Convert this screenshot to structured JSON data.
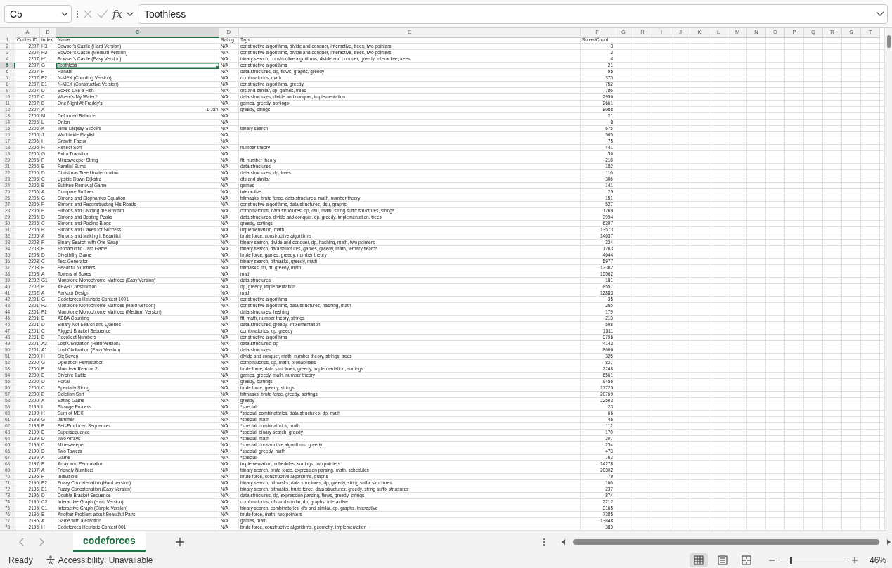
{
  "formula_bar": {
    "name_box": "C5",
    "function_label": "fx",
    "formula": "Toothless"
  },
  "columns": [
    {
      "label": "A",
      "selected": false
    },
    {
      "label": "B",
      "selected": false
    },
    {
      "label": "C",
      "selected": true
    },
    {
      "label": "D",
      "selected": false
    },
    {
      "label": "E",
      "selected": false
    },
    {
      "label": "F",
      "selected": false
    },
    {
      "label": "G",
      "selected": false
    },
    {
      "label": "H",
      "selected": false
    },
    {
      "label": "I",
      "selected": false
    },
    {
      "label": "J",
      "selected": false
    },
    {
      "label": "K",
      "selected": false
    },
    {
      "label": "L",
      "selected": false
    },
    {
      "label": "M",
      "selected": false
    },
    {
      "label": "N",
      "selected": false
    },
    {
      "label": "O",
      "selected": false
    },
    {
      "label": "P",
      "selected": false
    },
    {
      "label": "Q",
      "selected": false
    },
    {
      "label": "R",
      "selected": false
    },
    {
      "label": "S",
      "selected": false
    },
    {
      "label": "T",
      "selected": false
    }
  ],
  "header": {
    "n": "1",
    "contest_id": "ContestID",
    "index": "Index",
    "name": "Name",
    "rating": "Rating",
    "tags": "Tags",
    "solved_count": "SolvedCount"
  },
  "rows": [
    {
      "n": "2",
      "selected": false,
      "contest_id": "2207",
      "index": "H3",
      "name": "Bowser's Castle (Hard Version)",
      "rating": "N/A",
      "tags": "constructive algorithms, divide and conquer, interactive, trees, two pointers",
      "solved_count": "3"
    },
    {
      "n": "3",
      "selected": false,
      "contest_id": "2207",
      "index": "H2",
      "name": "Bowser's Castle (Medium Version)",
      "rating": "N/A",
      "tags": "constructive algorithms, divide and conquer, interactive, trees, two pointers",
      "solved_count": "2"
    },
    {
      "n": "4",
      "selected": false,
      "contest_id": "2207",
      "index": "H1",
      "name": "Bowser's Castle (Easy Version)",
      "rating": "N/A",
      "tags": "binary search, constructive algorithms, divide and conquer, greedy, interactive, trees",
      "solved_count": "4"
    },
    {
      "n": "5",
      "selected": true,
      "contest_id": "2207",
      "index": "G",
      "name": "Toothless",
      "rating": "N/A",
      "tags": "constructive algorithms",
      "solved_count": "21"
    },
    {
      "n": "6",
      "selected": false,
      "contest_id": "2207",
      "index": "F",
      "name": "Hanabi",
      "rating": "N/A",
      "tags": "data structures, dp, flows, graphs, greedy",
      "solved_count": "95"
    },
    {
      "n": "7",
      "selected": false,
      "contest_id": "2207",
      "index": "E2",
      "name": "N-MEX (Counting Version)",
      "rating": "N/A",
      "tags": "combinatorics, math",
      "solved_count": "375"
    },
    {
      "n": "8",
      "selected": false,
      "contest_id": "2207",
      "index": "E1",
      "name": "N-MEX (Constructive Version)",
      "rating": "N/A",
      "tags": "constructive algorithms, greedy",
      "solved_count": "752"
    },
    {
      "n": "9",
      "selected": false,
      "contest_id": "2207",
      "index": "D",
      "name": "Boxed Like a Fish",
      "rating": "N/A",
      "tags": "dfs and similar, dp, games, trees",
      "solved_count": "786"
    },
    {
      "n": "10",
      "selected": false,
      "contest_id": "2207",
      "index": "C",
      "name": "Where's My Water?",
      "rating": "N/A",
      "tags": "data structures, divide and conquer, implementation",
      "solved_count": "2956"
    },
    {
      "n": "11",
      "selected": false,
      "contest_id": "2207",
      "index": "B",
      "name": "One Night At Freddy's",
      "rating": "N/A",
      "tags": "games, greedy, sortings",
      "solved_count": "2661"
    },
    {
      "n": "12",
      "selected": false,
      "contest_id": "2207",
      "index": "A",
      "date": "1-Jan",
      "rating": "N/A",
      "tags": "greedy, strings",
      "solved_count": "8088"
    },
    {
      "n": "13",
      "selected": false,
      "contest_id": "2206",
      "index": "M",
      "name": "Deformed Balance",
      "rating": "N/A",
      "solved_count": "21"
    },
    {
      "n": "14",
      "selected": false,
      "contest_id": "2206",
      "index": "L",
      "name": "Onion",
      "rating": "N/A",
      "solved_count": "8"
    },
    {
      "n": "15",
      "selected": false,
      "contest_id": "2206",
      "index": "K",
      "name": "Time Display Stickers",
      "rating": "N/A",
      "tags": "binary search",
      "solved_count": "675"
    },
    {
      "n": "16",
      "selected": false,
      "contest_id": "2206",
      "index": "J",
      "name": "Worldwide Playlist",
      "rating": "N/A",
      "solved_count": "505"
    },
    {
      "n": "17",
      "selected": false,
      "contest_id": "2206",
      "index": "I",
      "name": "Growth Factor",
      "rating": "N/A",
      "solved_count": "75"
    },
    {
      "n": "18",
      "selected": false,
      "contest_id": "2206",
      "index": "H",
      "name": "Reflect Sort",
      "rating": "N/A",
      "tags": "number theory",
      "solved_count": "441"
    },
    {
      "n": "19",
      "selected": false,
      "contest_id": "2206",
      "index": "G",
      "name": "Extra Transition",
      "rating": "N/A",
      "solved_count": "36"
    },
    {
      "n": "20",
      "selected": false,
      "contest_id": "2206",
      "index": "F",
      "name": "Minesweeper String",
      "rating": "N/A",
      "tags": "fft, number theory",
      "solved_count": "218"
    },
    {
      "n": "21",
      "selected": false,
      "contest_id": "2206",
      "index": "E",
      "name": "Parallel Sums",
      "rating": "N/A",
      "tags": "data structures",
      "solved_count": "182"
    },
    {
      "n": "22",
      "selected": false,
      "contest_id": "2206",
      "index": "D",
      "name": "Christmas Tree Un-decoration",
      "rating": "N/A",
      "tags": "data structures, dp, trees",
      "solved_count": "116"
    },
    {
      "n": "23",
      "selected": false,
      "contest_id": "2206",
      "index": "C",
      "name": "Upside Down Dijkstra",
      "rating": "N/A",
      "tags": "dfs and similar",
      "solved_count": "306"
    },
    {
      "n": "24",
      "selected": false,
      "contest_id": "2206",
      "index": "B",
      "name": "Subtree Removal Game",
      "rating": "N/A",
      "tags": "games",
      "solved_count": "141"
    },
    {
      "n": "25",
      "selected": false,
      "contest_id": "2206",
      "index": "A",
      "name": "Compare Suffixes",
      "rating": "N/A",
      "tags": "interactive",
      "solved_count": "25"
    },
    {
      "n": "26",
      "selected": false,
      "contest_id": "2205",
      "index": "G",
      "name": "Simons and Diophantus Equation",
      "rating": "N/A",
      "tags": "bitmasks, brute force, data structures, math, number theory",
      "solved_count": "151"
    },
    {
      "n": "27",
      "selected": false,
      "contest_id": "2205",
      "index": "F",
      "name": "Simons and Reconstructing His Roads",
      "rating": "N/A",
      "tags": "constructive algorithms, data structures, dsu, graphs",
      "solved_count": "527"
    },
    {
      "n": "28",
      "selected": false,
      "contest_id": "2205",
      "index": "E",
      "name": "Simons and Dividing the Rhythm",
      "rating": "N/A",
      "tags": "combinatorics, data structures, dp, dsu, math, string suffix structures, strings",
      "solved_count": "1269"
    },
    {
      "n": "29",
      "selected": false,
      "contest_id": "2205",
      "index": "D",
      "name": "Simons and Beating Peaks",
      "rating": "N/A",
      "tags": "data structures, divide and conquer, dp, greedy, implementation, trees",
      "solved_count": "3994"
    },
    {
      "n": "30",
      "selected": false,
      "contest_id": "2205",
      "index": "C",
      "name": "Simons and Posting Blogs",
      "rating": "N/A",
      "tags": "greedy, sortings",
      "solved_count": "6397"
    },
    {
      "n": "31",
      "selected": false,
      "contest_id": "2205",
      "index": "B",
      "name": "Simons and Cakes for Success",
      "rating": "N/A",
      "tags": "implementation, math",
      "solved_count": "13573"
    },
    {
      "n": "32",
      "selected": false,
      "contest_id": "2205",
      "index": "A",
      "name": "Simons and Making It Beautiful",
      "rating": "N/A",
      "tags": "brute force, constructive algorithms",
      "solved_count": "14637"
    },
    {
      "n": "33",
      "selected": false,
      "contest_id": "2203",
      "index": "F",
      "name": "Binary Search with One Swap",
      "rating": "N/A",
      "tags": "binary search, divide and conquer, dp, hashing, math, two pointers",
      "solved_count": "334"
    },
    {
      "n": "34",
      "selected": false,
      "contest_id": "2203",
      "index": "E",
      "name": "Probabilistic Card Game",
      "rating": "N/A",
      "tags": "binary search, data structures, games, greedy, math, ternary search",
      "solved_count": "1263"
    },
    {
      "n": "35",
      "selected": false,
      "contest_id": "2203",
      "index": "D",
      "name": "Divisibility Game",
      "rating": "N/A",
      "tags": "brute force, games, greedy, number theory",
      "solved_count": "4644"
    },
    {
      "n": "36",
      "selected": false,
      "contest_id": "2203",
      "index": "C",
      "name": "Test Generator",
      "rating": "N/A",
      "tags": "binary search, bitmasks, greedy, math",
      "solved_count": "5977"
    },
    {
      "n": "37",
      "selected": false,
      "contest_id": "2203",
      "index": "B",
      "name": "Beautiful Numbers",
      "rating": "N/A",
      "tags": "bitmasks, dp, fft, greedy, math",
      "solved_count": "12362"
    },
    {
      "n": "38",
      "selected": false,
      "contest_id": "2203",
      "index": "A",
      "name": "Towers of Boxes",
      "rating": "N/A",
      "tags": "math",
      "solved_count": "15562"
    },
    {
      "n": "39",
      "selected": false,
      "contest_id": "2202",
      "index": "G1",
      "name": "Monotone Monochrome Matrices (Easy Version)",
      "rating": "N/A",
      "tags": "data structures",
      "solved_count": "181"
    },
    {
      "n": "40",
      "selected": false,
      "contest_id": "2202",
      "index": "B",
      "name": "ABAB Construction",
      "rating": "N/A",
      "tags": "dp, greedy, implementation",
      "solved_count": "8557"
    },
    {
      "n": "41",
      "selected": false,
      "contest_id": "2202",
      "index": "A",
      "name": "Parkour Design",
      "rating": "N/A",
      "tags": "math",
      "solved_count": "12883"
    },
    {
      "n": "42",
      "selected": false,
      "contest_id": "2201",
      "index": "G",
      "name": "Codeforces Heuristic Contest 1001",
      "rating": "N/A",
      "tags": "constructive algorithms",
      "solved_count": "35"
    },
    {
      "n": "43",
      "selected": false,
      "contest_id": "2201",
      "index": "F2",
      "name": "Monotone Monochrome Matrices (Hard Version)",
      "rating": "N/A",
      "tags": "constructive algorithms, data structures, hashing, math",
      "solved_count": "265"
    },
    {
      "n": "44",
      "selected": false,
      "contest_id": "2201",
      "index": "F1",
      "name": "Monotone Monochrome Matrices (Medium Version)",
      "rating": "N/A",
      "tags": "data structures, hashing",
      "solved_count": "179"
    },
    {
      "n": "45",
      "selected": false,
      "contest_id": "2201",
      "index": "E",
      "name": "ABBA Counting",
      "rating": "N/A",
      "tags": "fft, math, number theory, strings",
      "solved_count": "213"
    },
    {
      "n": "46",
      "selected": false,
      "contest_id": "2201",
      "index": "D",
      "name": "Binary Not Search and Queries",
      "rating": "N/A",
      "tags": "data structures, greedy, implementation",
      "solved_count": "598"
    },
    {
      "n": "47",
      "selected": false,
      "contest_id": "2201",
      "index": "C",
      "name": "Rigged Bracket Sequence",
      "rating": "N/A",
      "tags": "combinatorics, dp, greedy",
      "solved_count": "1511"
    },
    {
      "n": "48",
      "selected": false,
      "contest_id": "2201",
      "index": "B",
      "name": "Recollect Numbers",
      "rating": "N/A",
      "tags": "constructive algorithms",
      "solved_count": "3796"
    },
    {
      "n": "49",
      "selected": false,
      "contest_id": "2201",
      "index": "A2",
      "name": "Lost Civilization (Hard Version)",
      "rating": "N/A",
      "tags": "data structures, dp",
      "solved_count": "4143"
    },
    {
      "n": "50",
      "selected": false,
      "contest_id": "2201",
      "index": "A1",
      "name": "Lost Civilization (Easy Version)",
      "rating": "N/A",
      "tags": "data structures",
      "solved_count": "8606"
    },
    {
      "n": "51",
      "selected": false,
      "contest_id": "2200",
      "index": "H",
      "name": "Six Seven",
      "rating": "N/A",
      "tags": "divide and conquer, math, number theory, strings, trees",
      "solved_count": "325"
    },
    {
      "n": "52",
      "selected": false,
      "contest_id": "2200",
      "index": "G",
      "name": "Operation Permutation",
      "rating": "N/A",
      "tags": "combinatorics, dp, math, probabilities",
      "solved_count": "827"
    },
    {
      "n": "53",
      "selected": false,
      "contest_id": "2200",
      "index": "F",
      "name": "Mooclear Reactor 2",
      "rating": "N/A",
      "tags": "brute force, data structures, greedy, implementation, sortings",
      "solved_count": "2248"
    },
    {
      "n": "54",
      "selected": false,
      "contest_id": "2200",
      "index": "E",
      "name": "Divisive Battle",
      "rating": "N/A",
      "tags": "games, greedy, math, number theory",
      "solved_count": "6561"
    },
    {
      "n": "55",
      "selected": false,
      "contest_id": "2200",
      "index": "D",
      "name": "Portal",
      "rating": "N/A",
      "tags": "greedy, sortings",
      "solved_count": "9456"
    },
    {
      "n": "56",
      "selected": false,
      "contest_id": "2200",
      "index": "C",
      "name": "Specialty String",
      "rating": "N/A",
      "tags": "brute force, greedy, strings",
      "solved_count": "17725"
    },
    {
      "n": "57",
      "selected": false,
      "contest_id": "2200",
      "index": "B",
      "name": "Deletion Sort",
      "rating": "N/A",
      "tags": "bitmasks, brute force, greedy, sortings",
      "solved_count": "20769"
    },
    {
      "n": "58",
      "selected": false,
      "contest_id": "2200",
      "index": "A",
      "name": "Eating Game",
      "rating": "N/A",
      "tags": "greedy",
      "solved_count": "22503"
    },
    {
      "n": "59",
      "selected": false,
      "contest_id": "2199",
      "index": "I",
      "name": "Strange Process",
      "rating": "N/A",
      "tags": "*special",
      "solved_count": "23"
    },
    {
      "n": "60",
      "selected": false,
      "contest_id": "2199",
      "index": "H",
      "name": "Sum of MEX",
      "rating": "N/A",
      "tags": "*special, combinatorics, data structures, dp, math",
      "solved_count": "66"
    },
    {
      "n": "61",
      "selected": false,
      "contest_id": "2199",
      "index": "G",
      "name": "Jammer",
      "rating": "N/A",
      "tags": "*special, math",
      "solved_count": "46"
    },
    {
      "n": "62",
      "selected": false,
      "contest_id": "2199",
      "index": "F",
      "name": "Self-Produced Sequences",
      "rating": "N/A",
      "tags": "*special, combinatorics, math",
      "solved_count": "112"
    },
    {
      "n": "63",
      "selected": false,
      "contest_id": "2199",
      "index": "E",
      "name": "Supersequence",
      "rating": "N/A",
      "tags": "*special, binary search, greedy",
      "solved_count": "170"
    },
    {
      "n": "64",
      "selected": false,
      "contest_id": "2199",
      "index": "D",
      "name": "Two Arrays",
      "rating": "N/A",
      "tags": "*special, math",
      "solved_count": "207"
    },
    {
      "n": "65",
      "selected": false,
      "contest_id": "2199",
      "index": "C",
      "name": "Minesweeper",
      "rating": "N/A",
      "tags": "*special, constructive algorithms, greedy",
      "solved_count": "234"
    },
    {
      "n": "66",
      "selected": false,
      "contest_id": "2199",
      "index": "B",
      "name": "Two Towers",
      "rating": "N/A",
      "tags": "*special, greedy, math",
      "solved_count": "473"
    },
    {
      "n": "67",
      "selected": false,
      "contest_id": "2199",
      "index": "A",
      "name": "Game",
      "rating": "N/A",
      "tags": "*special",
      "solved_count": "763"
    },
    {
      "n": "68",
      "selected": false,
      "contest_id": "2197",
      "index": "B",
      "name": "Array and Permutation",
      "rating": "N/A",
      "tags": "implementation, schedules, sortings, two pointers",
      "solved_count": "14278"
    },
    {
      "n": "69",
      "selected": false,
      "contest_id": "2197",
      "index": "A",
      "name": "Friendly Numbers",
      "rating": "N/A",
      "tags": "binary search, brute force, expression parsing, math, schedules",
      "solved_count": "20302"
    },
    {
      "n": "70",
      "selected": false,
      "contest_id": "2196",
      "index": "F",
      "name": "Indivisible",
      "rating": "N/A",
      "tags": "brute force, constructive algorithms, graphs",
      "solved_count": "79"
    },
    {
      "n": "71",
      "selected": false,
      "contest_id": "2196",
      "index": "E2",
      "name": "Fuzzy Concatenation (Hard version)",
      "rating": "N/A",
      "tags": "binary search, bitmasks, data structures, dp, greedy, string suffix structures",
      "solved_count": "166"
    },
    {
      "n": "72",
      "selected": false,
      "contest_id": "2196",
      "index": "E1",
      "name": "Fuzzy Concatenation (Easy Version)",
      "rating": "N/A",
      "tags": "binary search, bitmasks, brute force, data structures, greedy, string suffix structures",
      "solved_count": "237"
    },
    {
      "n": "73",
      "selected": false,
      "contest_id": "2196",
      "index": "D",
      "name": "Double Bracket Sequence",
      "rating": "N/A",
      "tags": "data structures, dp, expression parsing, flows, greedy, strings",
      "solved_count": "874"
    },
    {
      "n": "74",
      "selected": false,
      "contest_id": "2196",
      "index": "C2",
      "name": "Interactive Graph (Hard Version)",
      "rating": "N/A",
      "tags": "combinatorics, dfs and similar, dp, graphs, interactive",
      "solved_count": "2212"
    },
    {
      "n": "75",
      "selected": false,
      "contest_id": "2196",
      "index": "C1",
      "name": "Interactive Graph (Simple Version)",
      "rating": "N/A",
      "tags": "binary search, combinatorics, dfs and similar, dp, graphs, interactive",
      "solved_count": "3165"
    },
    {
      "n": "76",
      "selected": false,
      "contest_id": "2196",
      "index": "B",
      "name": "Another Problem about Beautiful Pairs",
      "rating": "N/A",
      "tags": "brute force, math, two pointers",
      "solved_count": "7385"
    },
    {
      "n": "77",
      "selected": false,
      "contest_id": "2196",
      "index": "A",
      "name": "Game with a Fraction",
      "rating": "N/A",
      "tags": "games, math",
      "solved_count": "13848"
    },
    {
      "n": "78",
      "selected": false,
      "contest_id": "2195",
      "index": "H",
      "name": "Codeforces Heuristic Contest 001",
      "rating": "N/A",
      "tags": "brute force, constructive algorithms, geometry, implementation",
      "solved_count": "383"
    }
  ],
  "sheet_tabs": [
    {
      "label": "codeforces",
      "selected": true
    }
  ],
  "status_bar": {
    "status": "Ready",
    "accessibility": "Accessibility: Unavailable",
    "views": [
      {
        "kind": "normal",
        "selected": true
      },
      {
        "kind": "page_layout",
        "selected": false
      },
      {
        "kind": "page_break",
        "selected": false
      }
    ],
    "zoom_slider": {
      "level": 0.18
    },
    "zoom": "46%"
  }
}
